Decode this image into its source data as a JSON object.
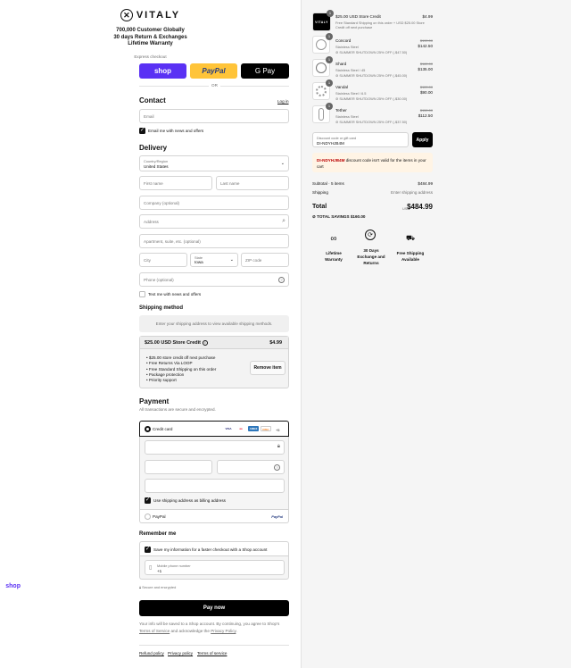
{
  "brand": "VITALY",
  "promo": [
    "700,000 Customer Globally",
    "30 days Return & Exchanges",
    "Lifetime Warranty"
  ],
  "express": {
    "label": "Express checkout",
    "shop": "shop",
    "paypal": "PayPal",
    "gpay": "G Pay",
    "or": "OR"
  },
  "contact": {
    "title": "Contact",
    "login": "Log in",
    "email_placeholder": "Email",
    "news": "Email me with news and offers"
  },
  "delivery": {
    "title": "Delivery",
    "country_label": "Country/Region",
    "country": "United States",
    "first_name": "First name",
    "last_name": "Last name",
    "company": "Company (optional)",
    "address": "Address",
    "apartment": "Apartment, suite, etc. (optional)",
    "city": "City",
    "state_label": "State",
    "state": "Iowa",
    "zip": "ZIP code",
    "phone": "Phone (optional)",
    "text_me": "Text me with news and offers"
  },
  "shipping": {
    "title": "Shipping method",
    "message": "Enter your shipping address to view available shipping methods."
  },
  "store_credit": {
    "title": "$25.00 USD Store Credit",
    "price": "$4.99",
    "perks": [
      "$25.00 store credit off next purchase",
      "Free Returns Via LOOP",
      "Free Standard Shipping on this order",
      "Package protection",
      "Priority support"
    ],
    "remove": "Remove item"
  },
  "payment": {
    "title": "Payment",
    "subtitle": "All transactions are secure and encrypted.",
    "credit_card": "Credit card",
    "cards": [
      "VISA",
      "MC",
      "AMEX",
      "DISC"
    ],
    "more_cards": "+5",
    "billing_same": "Use shipping address as billing address",
    "paypal": "PayPal",
    "paypal_logo": "PayPal"
  },
  "remember": {
    "title": "Remember me",
    "save_info": "Save my information for a faster checkout with a Shop account",
    "phone_label": "Mobile phone number",
    "phone_value": "+1",
    "secure": "Secure and encrypted",
    "shop_logo": "shop"
  },
  "pay_now": "Pay now",
  "legal": {
    "text1": "Your info will be saved to a Shop account. By continuing, you agree to Shop's",
    "terms": "Terms of Service",
    "and": "and acknowledge the",
    "privacy": "Privacy Policy",
    "dot": "."
  },
  "footer_links": [
    "Refund policy",
    "Privacy policy",
    "Terms of service"
  ],
  "cart": {
    "items": [
      {
        "qty": "1",
        "name": "$25.00 USD Store Credit",
        "variant": "Free Standard Shipping on this order + USD $25.00 Store Credit off next purchase",
        "discount": "",
        "old_price": "",
        "price": "$4.99",
        "image": "vitaly-logo-card"
      },
      {
        "qty": "1",
        "name": "Concord",
        "variant": "Stainless Steel",
        "discount": "SUMMER SHUTDOWN 25% OFF (-$47.50)",
        "old_price": "$190.00",
        "price": "$142.50",
        "image": "ring"
      },
      {
        "qty": "1",
        "name": "Shard",
        "variant": "Stainless Steel / 45",
        "discount": "SUMMER SHUTDOWN 25% OFF (-$45.00)",
        "old_price": "$180.00",
        "price": "$135.00",
        "image": "ring"
      },
      {
        "qty": "1",
        "name": "Vandal",
        "variant": "Stainless Steel / 6.5",
        "discount": "SUMMER SHUTDOWN 25% OFF (-$30.00)",
        "old_price": "$120.00",
        "price": "$90.00",
        "image": "ring"
      },
      {
        "qty": "1",
        "name": "Tether",
        "variant": "Stainless Steel",
        "discount": "SUMMER SHUTDOWN 25% OFF (-$37.50)",
        "old_price": "$150.00",
        "price": "$112.50",
        "image": "chain"
      }
    ],
    "discount_label": "Discount code or gift card",
    "discount_value": "DI-NDYHJB4M",
    "apply": "Apply",
    "error_code": "DI-NDYHJB4M",
    "error_text": "discount code isn't valid for the items in your cart",
    "subtotal_label": "Subtotal · 5 items",
    "subtotal": "$484.99",
    "shipping_label": "Shipping",
    "shipping_value": "Enter shipping address",
    "total_label": "Total",
    "currency": "USD",
    "total": "$484.99",
    "savings_label": "TOTAL SAVINGS",
    "savings": "$160.00"
  },
  "value_props": [
    {
      "icon": "infinity-icon",
      "label": "Lifetime Warranty"
    },
    {
      "icon": "exchange-icon",
      "label": "30 Days Exchange and Returns"
    },
    {
      "icon": "truck-icon",
      "label": "Free Shipping Available"
    }
  ],
  "colors": {
    "shop": "#5a31f4",
    "paypal": "#ffc439",
    "gpay": "#000000",
    "error_bg": "#fff4e5"
  }
}
